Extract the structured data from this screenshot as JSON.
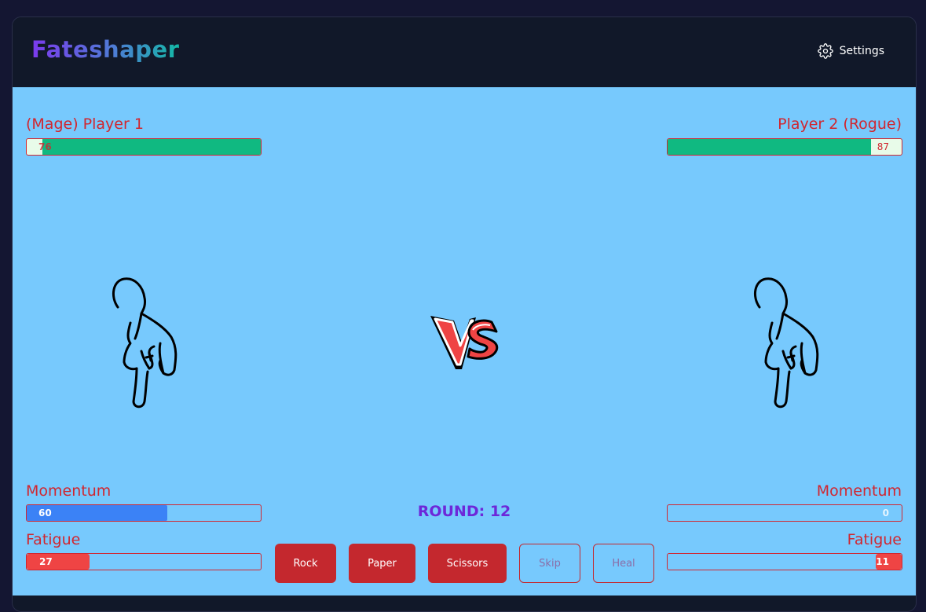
{
  "app": {
    "title": "Fateshaper",
    "settings_label": "Settings"
  },
  "player1": {
    "name": "(Mage)  Player 1",
    "health": 76,
    "momentum_label": "Momentum",
    "momentum": 60,
    "fatigue_label": "Fatigue",
    "fatigue": 27,
    "hand": "pointing-down-hand-icon"
  },
  "player2": {
    "name": "Player 2  (Rogue)",
    "health": 87,
    "momentum_label": "Momentum",
    "momentum": 0,
    "fatigue_label": "Fatigue",
    "fatigue": 11,
    "hand": "pointing-down-hand-icon"
  },
  "round_label": "ROUND: 12",
  "actions": [
    "Rock",
    "Paper",
    "Scissors",
    "Skip",
    "Heal"
  ],
  "colors": {
    "arena_bg": "#77c9fd",
    "health": "#10b981",
    "momentum": "#3b82f6",
    "fatigue": "#ef4444",
    "accent_red": "#c4282e",
    "round": "#6d28d9"
  }
}
